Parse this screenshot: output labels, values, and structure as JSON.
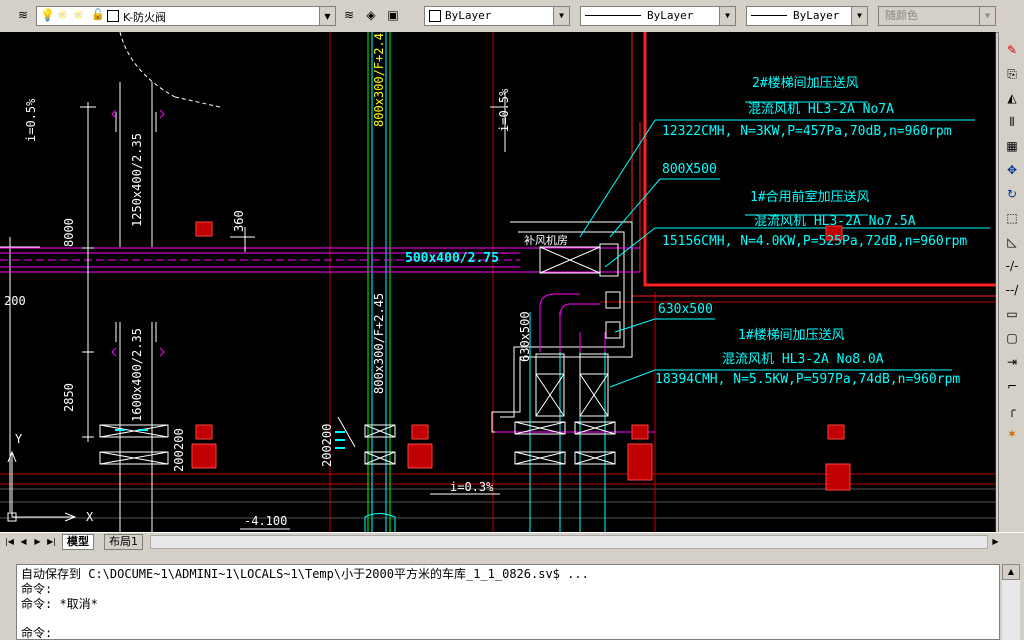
{
  "toolbar": {
    "layer_name": "K-防火阀",
    "color": "ByLayer",
    "linetype": "ByLayer",
    "lineweight": "ByLayer",
    "plotstyle": "随颜色"
  },
  "drawing": {
    "labels": {
      "slope_left": "i=0.5%",
      "slope_mid": "i=0.5%",
      "slope_bottom": "i=0.3%",
      "duct_1250": "1250x400/2.35",
      "duct_1600": "1600x400/2.35",
      "duct_800_top": "800x300/F+2.45",
      "duct_800_mid": "800x300/F+2.45",
      "duct_500_horiz": "500x400/2.75",
      "duct_630": "630x500",
      "dim_8000": "8000",
      "dim_360": "360",
      "dim_200_left": "200",
      "dim_2850": "2850",
      "dim_200200_a": "200",
      "dim_200200_b": "200",
      "dim_200200_c": "200200",
      "level_4100": "-4.100",
      "room_label": "补风机房",
      "size_800x500": "800X500",
      "size_630x500": "630x500",
      "fan2_title": "2#楼梯间加压送风",
      "fan2_model": "混流风机    HL3-2A    No7A",
      "fan2_spec": "12322CMH, N=3KW,P=457Pa,70dB,n=960rpm",
      "fan1a_title": "1#合用前室加压送风",
      "fan1a_model": "混流风机    HL3-2A    No7.5A",
      "fan1a_spec": "15156CMH, N=4.0KW,P=525Pa,72dB,n=960rpm",
      "fan1b_title": "1#楼梯间加压送风",
      "fan1b_model": "混流风机    HL3-2A    No8.0A",
      "fan1b_spec": "18394CMH, N=5.5KW,P=597Pa,74dB,n=960rpm",
      "axis_y": "Y",
      "axis_x": "X"
    }
  },
  "tabs": {
    "model": "模型",
    "layout1": "布局1"
  },
  "command": {
    "line1": "自动保存到 C:\\DOCUME~1\\ADMINI~1\\LOCALS~1\\Temp\\小于2000平方米的车库_1_1_0826.sv$ ...",
    "line2": "命令:",
    "line3": "命令: *取消*",
    "line4": "命令:"
  },
  "colors": {
    "cyan": "#00ffff",
    "magenta": "#ff00ff",
    "red": "#ff0000",
    "green": "#00ff00",
    "white": "#ffffff",
    "yellow": "#ffff00"
  }
}
